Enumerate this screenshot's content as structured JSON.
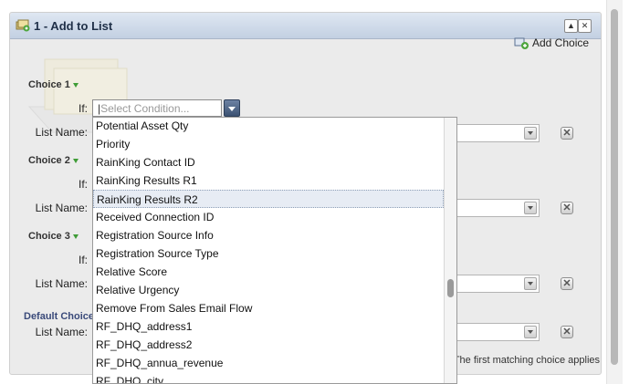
{
  "panel": {
    "title": "1 - Add to List",
    "collapse_icon": "triangle-up-icon",
    "close_icon": "close-x-icon"
  },
  "add_choice": {
    "label": "Add Choice",
    "icon": "add-choice-icon"
  },
  "choices": [
    {
      "label": "Choice 1",
      "if_label": "If:",
      "list_label": "List Name:"
    },
    {
      "label": "Choice 2",
      "if_label": "If:",
      "list_label": "List Name:"
    },
    {
      "label": "Choice 3",
      "if_label": "If:",
      "list_label": "List Name:"
    }
  ],
  "default_choice": {
    "label": "Default Choice",
    "list_label": "List Name:"
  },
  "condition": {
    "placeholder": "Select Condition..."
  },
  "footer_note": "The first matching choice applies",
  "dropdown": {
    "selected_index": 4,
    "scroll_position": 0.65,
    "items": [
      "Potential Asset Qty",
      "Priority",
      "RainKing Contact ID",
      "RainKing Results R1",
      "RainKing Results R2",
      "Received Connection ID",
      "Registration Source Info",
      "Registration Source Type",
      "Relative Score",
      "Relative Urgency",
      "Remove From Sales Email Flow",
      "RF_DHQ_address1",
      "RF_DHQ_address2",
      "RF_DHQ_annua_revenue",
      "RF_DHQ_city"
    ]
  },
  "colors": {
    "header": "#c3d0e2",
    "accent_green": "#3e9c36",
    "selected_row": "#e7ecf4"
  }
}
